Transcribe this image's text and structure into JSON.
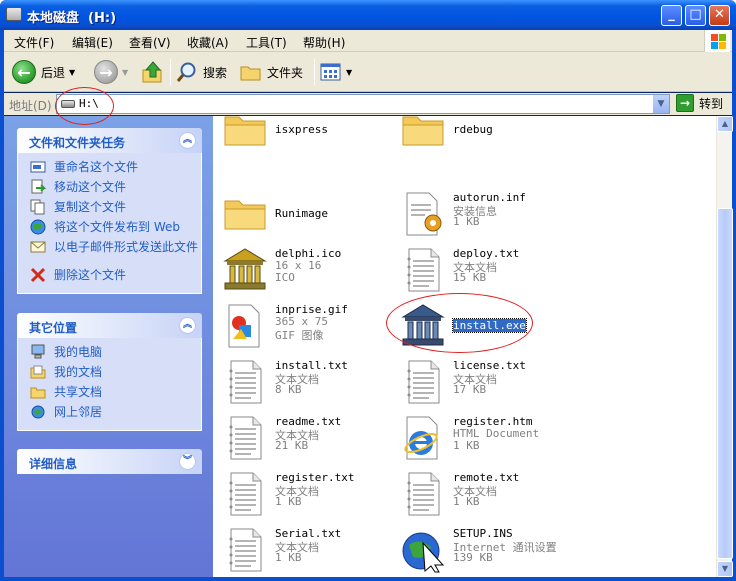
{
  "window": {
    "title": "本地磁盘  (H:)",
    "minimize": "_",
    "maximize": "□",
    "close": "✕"
  },
  "menu": [
    "文件(F)",
    "编辑(E)",
    "查看(V)",
    "收藏(A)",
    "工具(T)",
    "帮助(H)"
  ],
  "toolbar": {
    "back": "后退",
    "search": "搜索",
    "folders": "文件夹"
  },
  "address": {
    "label": "地址(D)",
    "value": "H:\\",
    "go": "转到"
  },
  "tasks_panel": {
    "title": "文件和文件夹任务",
    "items": [
      "重命名这个文件",
      "移动这个文件",
      "复制这个文件",
      "将这个文件发布到 Web",
      "以电子邮件形式发送此文件",
      "删除这个文件"
    ]
  },
  "places_panel": {
    "title": "其它位置",
    "items": [
      "我的电脑",
      "我的文档",
      "共享文档",
      "网上邻居"
    ]
  },
  "details_panel": {
    "title": "详细信息"
  },
  "files": [
    {
      "name": "isxpress",
      "type": "folder"
    },
    {
      "name": "rdebug",
      "type": "folder"
    },
    {
      "name": "Runimage",
      "type": "folder"
    },
    {
      "name": "autorun.inf",
      "line2": "安装信息",
      "line3": "1 KB",
      "type": "inf"
    },
    {
      "name": "delphi.ico",
      "line2": "16 x 16",
      "line3": "ICO",
      "type": "temple"
    },
    {
      "name": "deploy.txt",
      "line2": "文本文档",
      "line3": "15 KB",
      "type": "txt"
    },
    {
      "name": "inprise.gif",
      "line2": "365 x 75",
      "line3": "GIF 图像",
      "type": "gif"
    },
    {
      "name": "install.exe",
      "type": "temple-blue",
      "selected": true
    },
    {
      "name": "install.txt",
      "line2": "文本文档",
      "line3": "8 KB",
      "type": "txt"
    },
    {
      "name": "license.txt",
      "line2": "文本文档",
      "line3": "17 KB",
      "type": "txt"
    },
    {
      "name": "readme.txt",
      "line2": "文本文档",
      "line3": "21 KB",
      "type": "txt"
    },
    {
      "name": "register.htm",
      "line2": "HTML Document",
      "line3": "1 KB",
      "type": "ie"
    },
    {
      "name": "register.txt",
      "line2": "文本文档",
      "line3": "1 KB",
      "type": "txt"
    },
    {
      "name": "remote.txt",
      "line2": "文本文档",
      "line3": "1 KB",
      "type": "txt"
    },
    {
      "name": "Serial.txt",
      "line2": "文本文档",
      "line3": "1 KB",
      "type": "txt"
    },
    {
      "name": "SETUP.INS",
      "line2": "Internet 通讯设置",
      "line3": "139 KB",
      "type": "globe"
    }
  ]
}
